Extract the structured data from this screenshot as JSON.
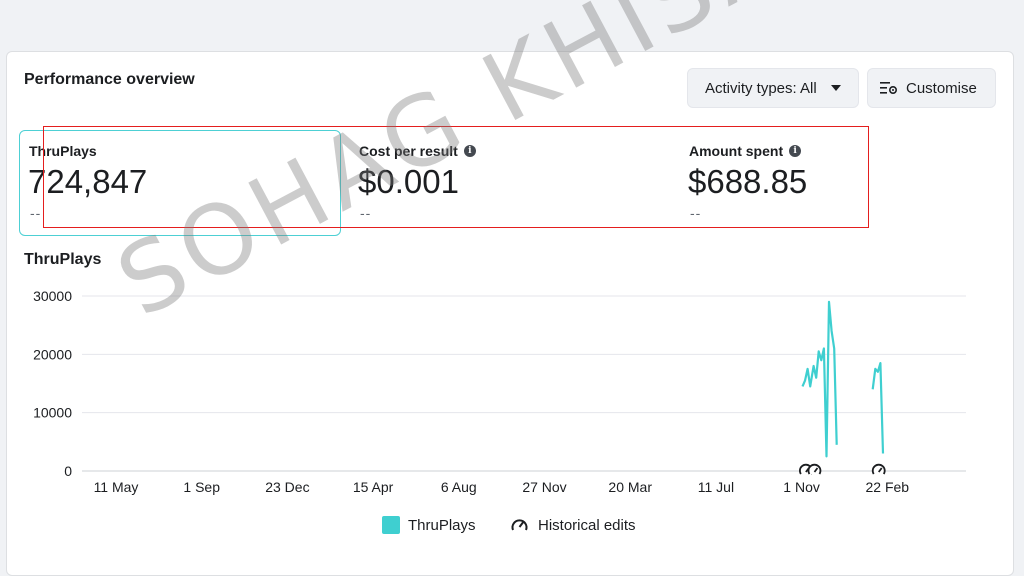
{
  "header": {
    "title": "Performance overview",
    "activity_label": "Activity types: All",
    "customise_label": "Customise"
  },
  "metrics": [
    {
      "label": "ThruPlays",
      "value": "724,847",
      "comparison": "--"
    },
    {
      "label": "Cost per result",
      "value": "$0.001",
      "comparison": "--"
    },
    {
      "label": "Amount spent",
      "value": "$688.85",
      "comparison": "--"
    }
  ],
  "chart_title": "ThruPlays",
  "legend": {
    "series": "ThruPlays",
    "edits": "Historical edits"
  },
  "watermark": "SOHAG KHISA",
  "colors": {
    "series": "#3fcfd0",
    "selected_border": "#4dd0d4",
    "highlight_box": "#e41e1e"
  },
  "icons": [
    "caret-down-icon",
    "customise-settings-icon",
    "info-icon",
    "historical-edit-icon"
  ],
  "chart_data": {
    "type": "line",
    "ylim": [
      0,
      30000
    ],
    "y_ticks": [
      0,
      10000,
      20000,
      30000
    ],
    "x_ticks": [
      "11 May",
      "1 Sep",
      "23 Dec",
      "15 Apr",
      "6 Aug",
      "27 Nov",
      "20 Mar",
      "11 Jul",
      "1 Nov",
      "22 Feb"
    ],
    "grid": true,
    "series": [
      {
        "name": "ThruPlays",
        "segments": [
          [
            [
              8.01,
              14500
            ],
            [
              8.04,
              15500
            ],
            [
              8.07,
              17500
            ],
            [
              8.1,
              14500
            ],
            [
              8.14,
              18000
            ],
            [
              8.17,
              16000
            ],
            [
              8.2,
              20500
            ],
            [
              8.23,
              19000
            ],
            [
              8.26,
              21000
            ],
            [
              8.29,
              2500
            ],
            [
              8.32,
              29000
            ],
            [
              8.35,
              24000
            ],
            [
              8.38,
              21000
            ],
            [
              8.41,
              4500
            ]
          ],
          [
            [
              8.83,
              14000
            ],
            [
              8.86,
              17500
            ],
            [
              8.89,
              17000
            ],
            [
              8.92,
              18500
            ],
            [
              8.95,
              3000
            ]
          ]
        ]
      }
    ],
    "historical_edit_markers": [
      8.05,
      8.15,
      8.9
    ]
  }
}
